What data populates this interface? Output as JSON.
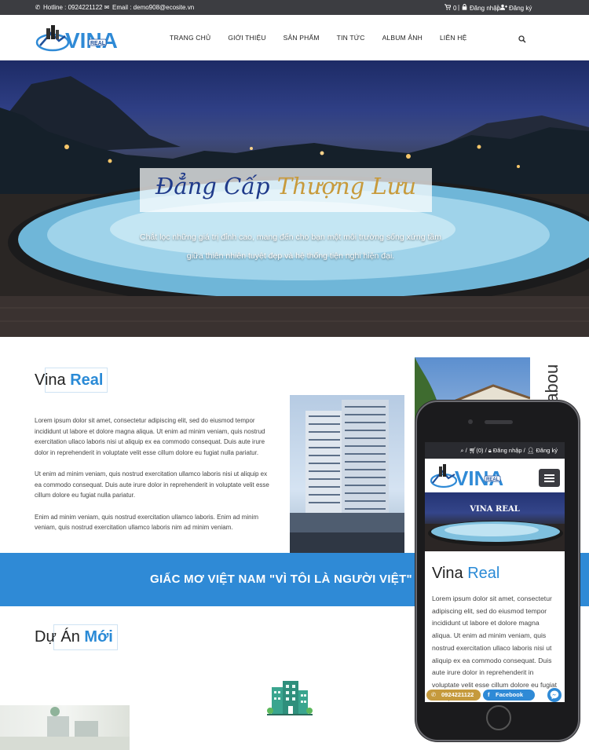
{
  "topbar": {
    "hotline": "Hotline : 0924221122",
    "email": "Email : demo908@ecosite.vn",
    "cart_count": "0",
    "login": "Đăng nhập",
    "register": "Đăng ký",
    "separator": "|"
  },
  "brand": {
    "logo_main": "VINA",
    "logo_small": "REAL"
  },
  "nav": [
    "TRANG CHỦ",
    "GIỚI THIỆU",
    "SẢN PHẨM",
    "TIN TỨC",
    "ALBUM ẢNH",
    "LIÊN HỆ"
  ],
  "hero": {
    "title_part1": "Đẳng Cấp",
    "title_part2": "Thượng Lưu",
    "subtitle_line1": "Chắt lọc những giá trị đỉnh cao, mang đến cho bạn một môi trường sống xứng tầm",
    "subtitle_line2": "giữa thiên nhiên tuyệt đẹp và hệ thống tiện nghi hiện đại."
  },
  "about": {
    "heading_plain": "Vina",
    "heading_bold": "Real",
    "paragraphs": [
      "Lorem ipsum dolor sit amet, consectetur adipiscing elit, sed do eiusmod tempor incididunt ut labore et dolore magna aliqua. Ut enim ad minim veniam, quis nostrud exercitation ullaco laboris nisi ut aliquip ex ea commodo consequat. Duis aute irure dolor in reprehenderit in voluptate velit esse cillum dolore eu fugiat nulla pariatur.",
      "Ut enim ad minim veniam, quis nostrud exercitation ullamco laboris nisi ut aliquip ex ea commodo consequat. Duis aute irure dolor in reprehenderit in voluptate velit esse cillum dolore eu fugiat nulla pariatur.",
      "Enim ad minim veniam, quis nostrud exercitation ullamco laboris. Enim ad minim veniam, quis nostrud exercitation ullamco laboris nim ad minim veniam."
    ],
    "vertical_label": "-abou"
  },
  "banner": {
    "text": "GIẤC MƠ VIỆT NAM \"VÌ TÔI LÀ NGƯỜI VIỆT\""
  },
  "projects": {
    "heading_plain": "Dự Án",
    "heading_bold": "Mới"
  },
  "phone": {
    "top_login": "Đăng nhập",
    "top_register": "Đăng ký",
    "top_cart": "(0)",
    "heading_plain": "Vina",
    "heading_bold": "Real",
    "hero_caption": "VINA REAL",
    "text": "Lorem ipsum dolor sit amet, consectetur adipiscing elit, sed do eiusmod tempor incididunt ut labore et dolore magna aliqua. Ut enim ad minim veniam, quis nostrud exercitation ullaco laboris nisi ut aliquip ex ea commodo consequat. Duis aute irure dolor in reprehenderit in voluptate velit esse cillum dolore eu fugiat nulla pariatur.",
    "call_label": "0924221122",
    "facebook_label": "Facebook"
  },
  "icons": {
    "phone": "phone-icon",
    "email": "envelope-icon",
    "cart": "cart-icon",
    "lock": "lock-icon",
    "user": "user-plus-icon",
    "search": "search-icon",
    "menu": "hamburger-icon",
    "messenger": "messenger-icon"
  },
  "colors": {
    "topbar": "#3c3d41",
    "accent_blue": "#2f8ad6",
    "gold": "#c79a3b",
    "title_blue": "#1f3a8a"
  }
}
